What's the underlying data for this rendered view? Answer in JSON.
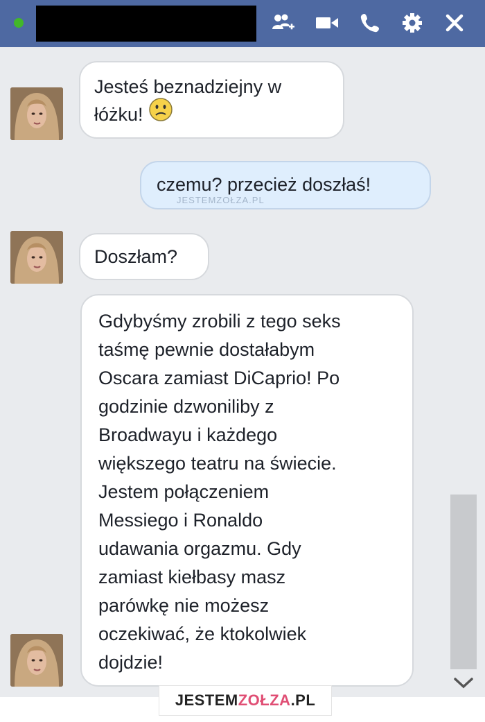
{
  "colors": {
    "header": "#4e69a2",
    "chat_background": "#e9ebee",
    "incoming_bubble": "#ffffff",
    "outgoing_bubble": "#dfeefd",
    "online": "#42b72a",
    "watermark_accent": "#e04e74"
  },
  "header": {
    "icons": [
      "add-friend-icon",
      "video-call-icon",
      "phone-icon",
      "gear-icon",
      "close-icon"
    ]
  },
  "messages": [
    {
      "direction": "incoming",
      "text": "Jesteś beznadziejny w\nłóżku! "
    },
    {
      "direction": "outgoing",
      "text": "czemu? przecież doszłaś!"
    },
    {
      "direction": "incoming",
      "text": "Doszłam?"
    },
    {
      "direction": "incoming",
      "text": "Gdybyśmy zrobili z tego seks\ntaśmę pewnie dostałabym\nOscara zamiast DiCaprio! Po\ngodzinie dzwoniliby z\nBroadwayu i każdego\nwiększego teatru na świecie.\nJestem połączeniem\nMessiego i Ronaldo\nudawania orgazmu. Gdy\nzamiast kiełbasy masz\nparówkę nie możesz\noczekiwać, że ktokolwiek\ndojdzie!"
    }
  ],
  "emoji": "confused-face",
  "watermark": {
    "inline": "JESTEMZOŁZA.PL",
    "prefix": "JESTEM",
    "accent": "ZOŁZA",
    "suffix": ".PL"
  }
}
